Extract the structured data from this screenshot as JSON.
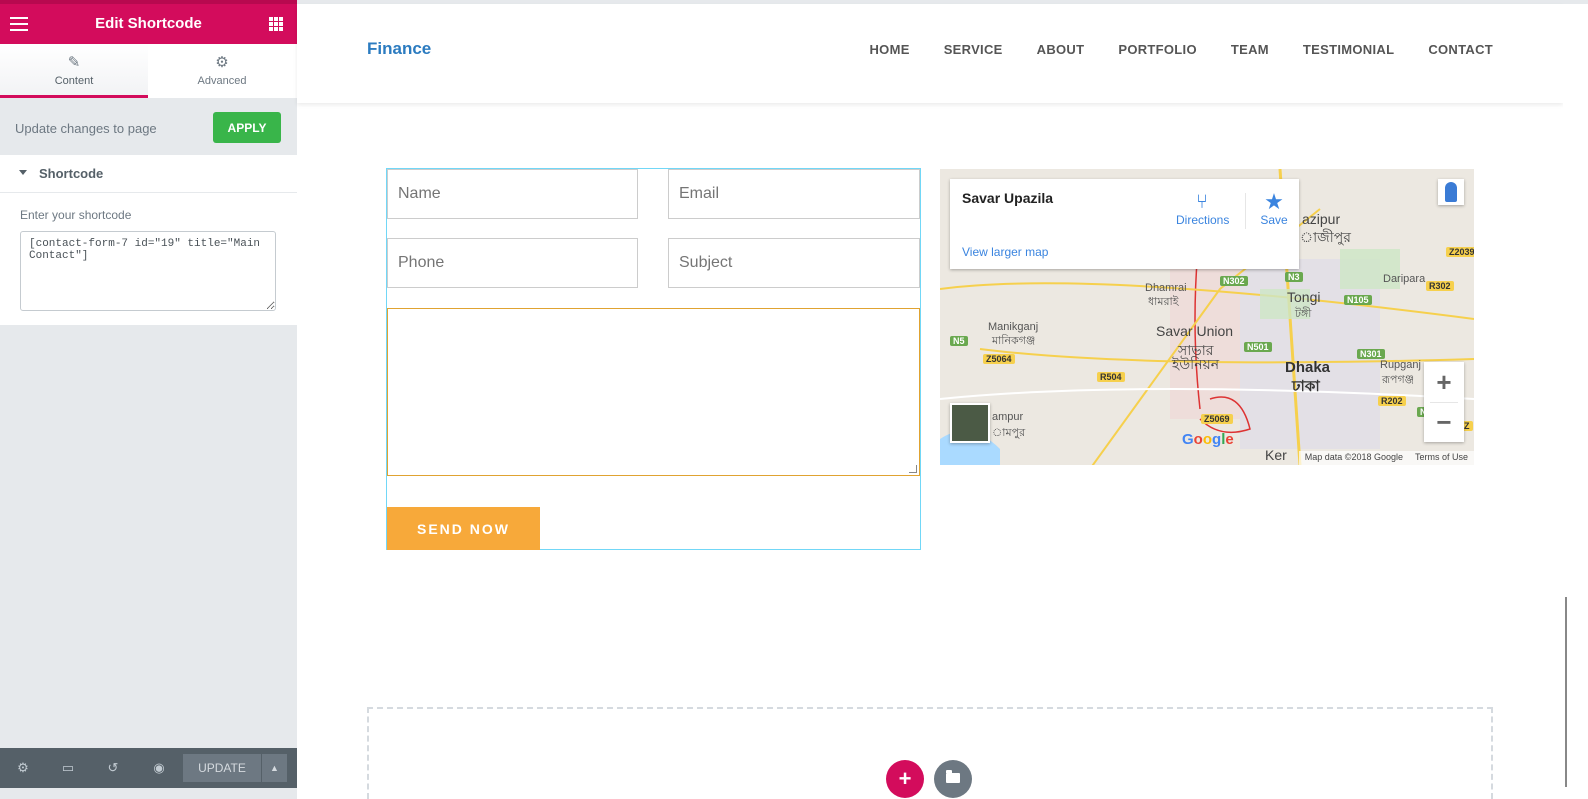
{
  "panel": {
    "header_title": "Edit Shortcode",
    "tabs": [
      {
        "label": "Content",
        "icon": "pencil-icon",
        "active": true
      },
      {
        "label": "Advanced",
        "icon": "gear-icon",
        "active": false
      }
    ],
    "apply_text": "Update changes to page",
    "apply_label": "APPLY",
    "section_title": "Shortcode",
    "field_label": "Enter your shortcode",
    "field_value": "[contact-form-7 id=\"19\" title=\"Main Contact\"]",
    "footer": {
      "update_label": "UPDATE",
      "icons": [
        "settings-icon",
        "responsive-icon",
        "history-icon",
        "preview-icon",
        "caret-up-icon"
      ]
    },
    "colors": {
      "accent": "#d30c5c",
      "apply": "#39b54a",
      "footer": "#556068"
    }
  },
  "site": {
    "brand": "Finance",
    "nav": [
      "HOME",
      "SERVICE",
      "ABOUT",
      "PORTFOLIO",
      "TEAM",
      "TESTIMONIAL",
      "CONTACT"
    ],
    "form": {
      "name_placeholder": "Name",
      "email_placeholder": "Email",
      "phone_placeholder": "Phone",
      "subject_placeholder": "Subject",
      "send_label": "SEND NOW"
    },
    "map": {
      "place": "Savar Upazila",
      "directions_label": "Directions",
      "save_label": "Save",
      "larger_map_label": "View larger map",
      "labels": {
        "savar_union": "Savar Union",
        "savar_union_bn1": "সাভার",
        "savar_union_bn2": "ইউনিয়ন",
        "dhaka": "Dhaka",
        "dhaka_bn": "ঢাকা",
        "tongi": "Tongi",
        "tongi_bn": "টঙ্গী",
        "dhamrai": "Dhamrai",
        "dhamrai_bn": "ধামরাই",
        "manikganj": "Manikganj",
        "manikganj_bn": "মানিকগঞ্জ",
        "daripara": "Daripara",
        "rupganj": "Rupganj",
        "rupganj_bn": "রূপগঞ্জ",
        "gazipur": "azipur",
        "gazipur_bn": "াজীপুর",
        "ampur": "ampur",
        "ampur_bn": "ামপুর",
        "keraniganj": "Ker"
      },
      "shields": {
        "n3": "N3",
        "n302": "N302",
        "n105": "N105",
        "r302": "R302",
        "z2039": "Z2039",
        "n5": "N5",
        "z5064": "Z5064",
        "n501": "N501",
        "n301": "N301",
        "r504": "R504",
        "r202": "R202",
        "n2": "N2",
        "z5069": "Z5069",
        "z": "Z"
      },
      "attribution": "Map data ©2018 Google",
      "terms": "Terms of Use",
      "zoom_in": "+",
      "zoom_out": "−"
    },
    "add_section_label": "+"
  }
}
